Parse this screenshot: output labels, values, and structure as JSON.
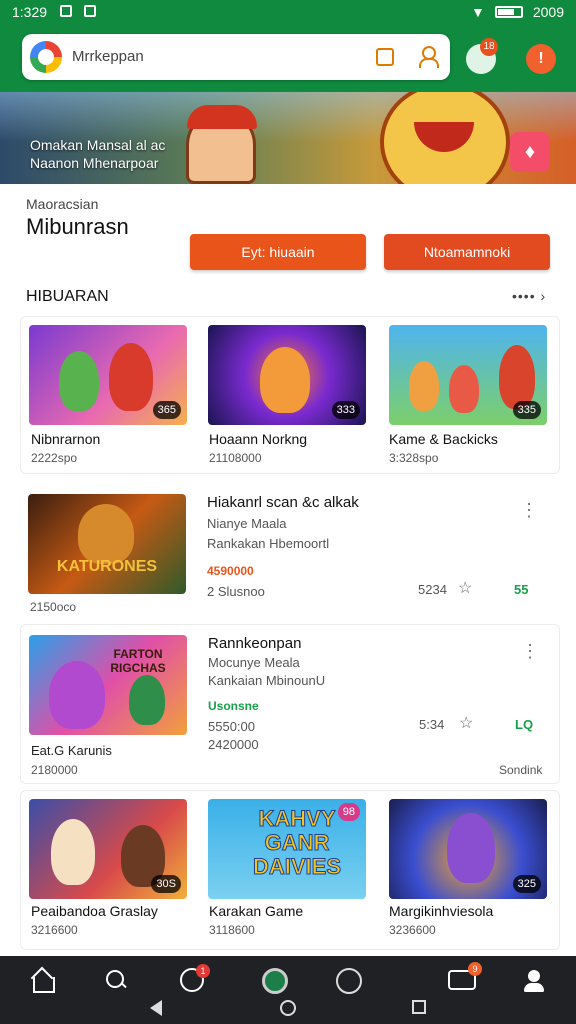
{
  "status_bar": {
    "time": "1:329",
    "right_text": "2009"
  },
  "search": {
    "placeholder": "Mrrkeppan"
  },
  "header": {
    "notification_count": "18",
    "chat_symbol": "!"
  },
  "banner": {
    "line1": "Omakan Mansal al ac",
    "line2": "Naanon Mhenarpoar"
  },
  "profile": {
    "sub_label": "Maoracsian",
    "title": "Mibunrasn",
    "button_primary": "Eyt: hiuaain",
    "button_secondary": "Ntoamamnoki"
  },
  "section": {
    "title": "HIBUARAN",
    "more": "•••• ›"
  },
  "grid_top": [
    {
      "title": "Nibnrarnon",
      "sub": "2222spo",
      "badge": "365"
    },
    {
      "title": "Hoaann Norkng",
      "sub": "21108000",
      "badge": "333"
    },
    {
      "title": "Kame & Backicks",
      "sub": "3:328spo",
      "badge": "335"
    }
  ],
  "list_rows": [
    {
      "thumb_text": "KATURONES",
      "title": "Hiakanrl scan &c alkak",
      "line1": "Nianye Maala",
      "line2": "Rankakan Hbemoortl",
      "price": "4590000",
      "below_price": "2 Slusnoo",
      "below_thumb": "2150oco",
      "num": "5234",
      "score": "55"
    },
    {
      "thumb_text": "FARTON RIGCHAS",
      "title": "Rannkeonpan",
      "line1": "Mocunye Meala",
      "line2": "Kankaian MbinounU",
      "price": "Usonsne",
      "below_price": "5550:00",
      "below_price2": "2420000",
      "below_thumb": "Eat.G Karunis",
      "below_thumb2": "2180000",
      "num": "5:34",
      "score": "LQ",
      "footer": "Sondink"
    }
  ],
  "grid_bottom": [
    {
      "title": "Peaibandoa Graslay",
      "sub": "3216600",
      "badge": "30S",
      "thumb_text": ""
    },
    {
      "title": "Karakan Game",
      "sub": "3118600",
      "badge": "98",
      "thumb_text": "KAHVY GANR DAIVIES"
    },
    {
      "title": "Margikinhviesola",
      "sub": "3236600",
      "badge": "325",
      "thumb_text": ""
    }
  ],
  "colors": {
    "header_green": "#0f8a3e",
    "accent_orange": "#e8541a",
    "score_green": "#19a04a"
  }
}
